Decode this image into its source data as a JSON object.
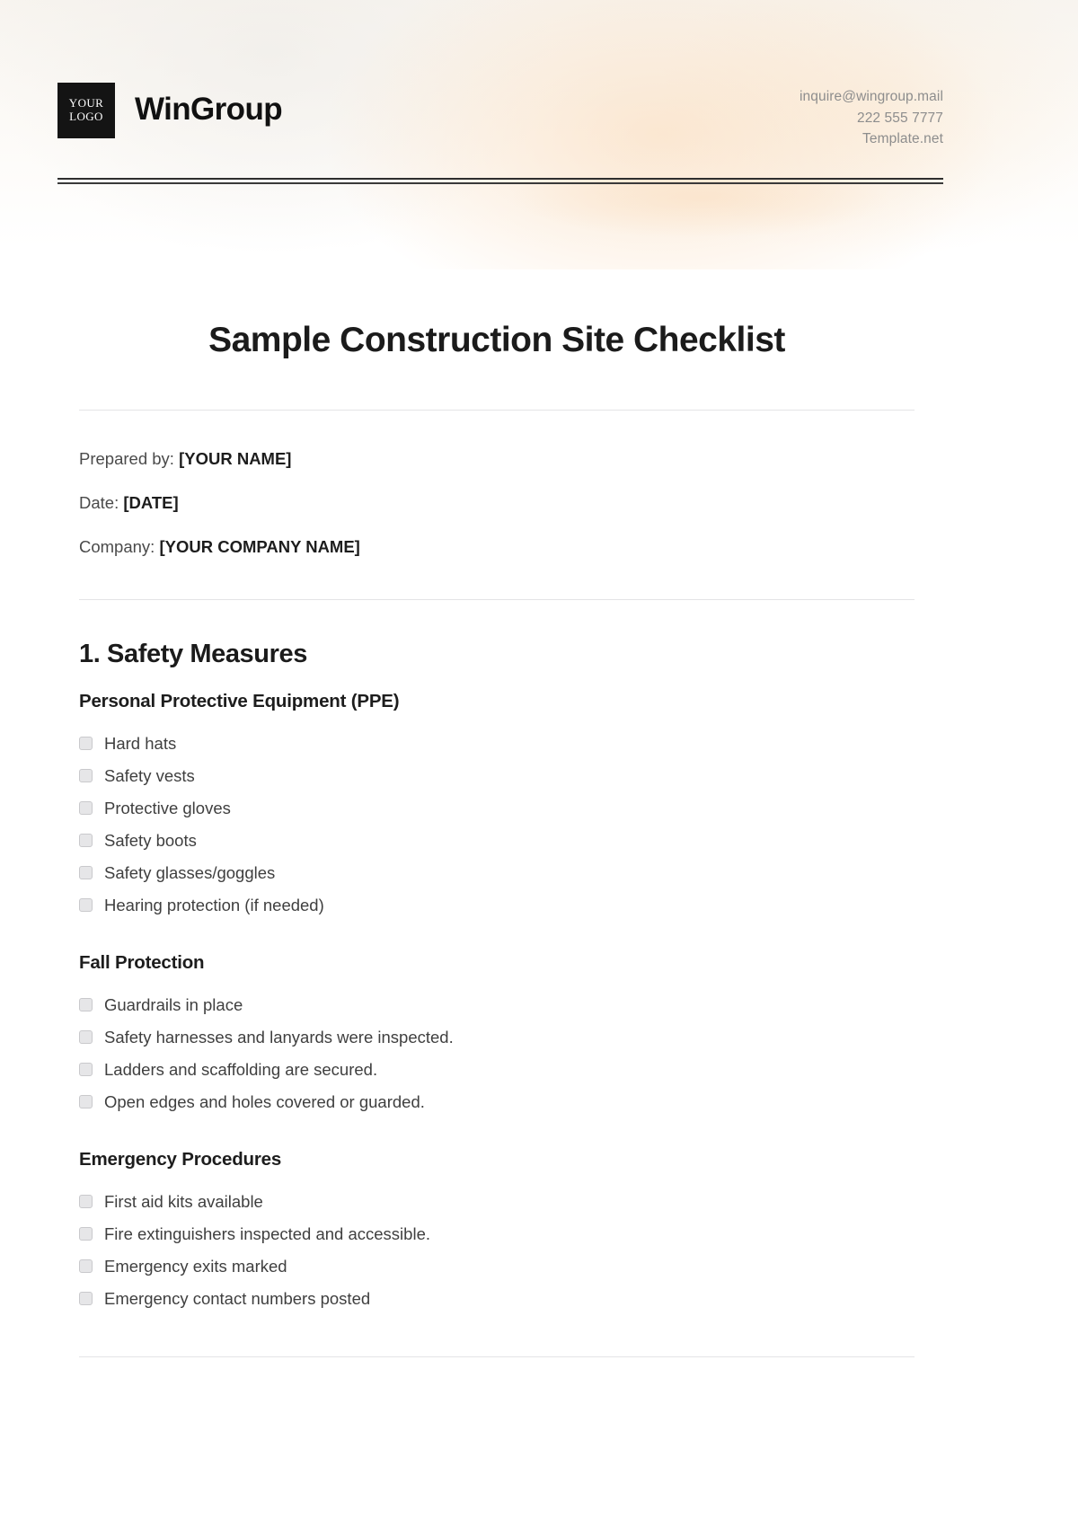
{
  "header": {
    "logo": {
      "line1": "YOUR",
      "line2": "LOGO"
    },
    "brand_name": "WinGroup",
    "contact": {
      "email": "inquire@wingroup.mail",
      "phone": "222 555 7777",
      "website": "Template.net"
    }
  },
  "document": {
    "title": "Sample Construction Site Checklist",
    "meta": [
      {
        "label": "Prepared by:",
        "value": "[YOUR NAME]"
      },
      {
        "label": "Date:",
        "value": "[DATE]"
      },
      {
        "label": "Company:",
        "value": "[YOUR COMPANY NAME]"
      }
    ],
    "sections": [
      {
        "title": "1. Safety Measures",
        "subsections": [
          {
            "title": "Personal Protective Equipment (PPE)",
            "items": [
              "Hard hats",
              "Safety vests",
              "Protective gloves",
              "Safety boots",
              "Safety glasses/goggles",
              "Hearing protection (if needed)"
            ]
          },
          {
            "title": "Fall Protection",
            "items": [
              "Guardrails in place",
              "Safety harnesses and lanyards were inspected.",
              "Ladders and scaffolding are secured.",
              "Open edges and holes covered or guarded."
            ]
          },
          {
            "title": "Emergency Procedures",
            "items": [
              "First aid kits available",
              "Fire extinguishers inspected and accessible.",
              "Emergency exits marked",
              "Emergency contact numbers posted"
            ]
          }
        ]
      }
    ]
  },
  "colors": {
    "logo_background": "#141414",
    "text_primary": "#1b1b1b",
    "text_body": "#3f3f3f",
    "text_muted": "#8d8d8d",
    "rule": "#e4e4e6",
    "checkbox_fill": "#e6e6e8"
  }
}
